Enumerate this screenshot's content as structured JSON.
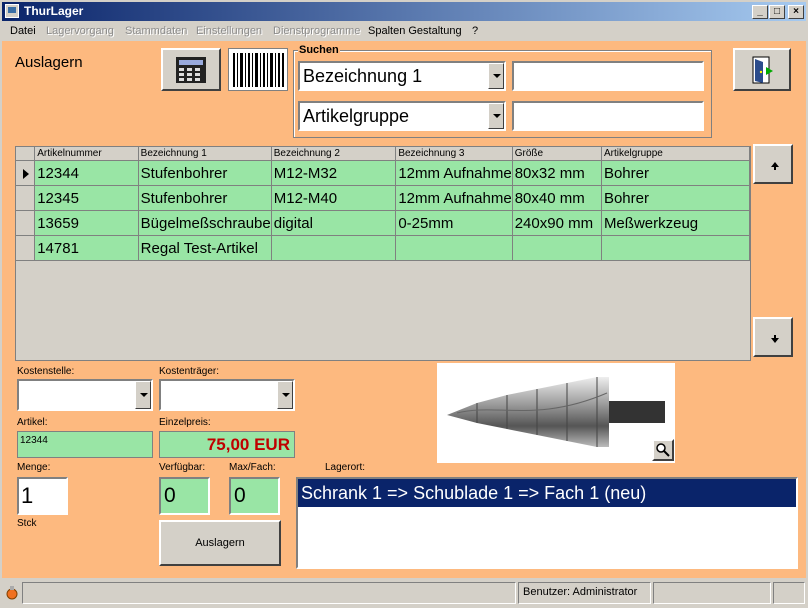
{
  "window": {
    "title": "ThurLager"
  },
  "menu": {
    "items": [
      {
        "label": "Datei",
        "enabled": true
      },
      {
        "label": "Lagervorgang",
        "enabled": false
      },
      {
        "label": "Stammdaten",
        "enabled": false
      },
      {
        "label": "Einstellungen",
        "enabled": false
      },
      {
        "label": "Dienstprogramme",
        "enabled": false
      },
      {
        "label": "Spalten Gestaltung",
        "enabled": true
      },
      {
        "label": "?",
        "enabled": true
      }
    ]
  },
  "page": {
    "title": "Auslagern"
  },
  "search": {
    "group_label": "Suchen",
    "combo1": "Bezeichnung 1",
    "combo2": "Artikelgruppe",
    "field1_value": "",
    "field2_value": ""
  },
  "table": {
    "columns": [
      "Artikelnummer",
      "Bezeichnung 1",
      "Bezeichnung 2",
      "Bezeichnung 3",
      "Größe",
      "Artikelgruppe"
    ],
    "rows": [
      [
        "12344",
        "Stufenbohrer",
        "M12-M32",
        "12mm Aufnahme",
        "80x32 mm",
        "Bohrer"
      ],
      [
        "12345",
        "Stufenbohrer",
        "M12-M40",
        "12mm Aufnahme",
        "80x40 mm",
        "Bohrer"
      ],
      [
        "13659",
        "Bügelmeßschraube",
        "digital",
        "0-25mm",
        "240x90 mm",
        "Meßwerkzeug"
      ],
      [
        "14781",
        "Regal Test-Artikel",
        "",
        "",
        "",
        ""
      ]
    ]
  },
  "form": {
    "kostenstelle_label": "Kostenstelle:",
    "kostentraeger_label": "Kostenträger:",
    "kostenstelle_value": "",
    "kostentraeger_value": "",
    "artikel_label": "Artikel:",
    "artikel_value": "12344",
    "einzelpreis_label": "Einzelpreis:",
    "einzelpreis_value": "75,00 EUR",
    "menge_label": "Menge:",
    "menge_value": "1",
    "unit": "Stck",
    "verfuegbar_label": "Verfügbar:",
    "verfuegbar_value": "0",
    "maxfach_label": "Max/Fach:",
    "maxfach_value": "0",
    "lagerort_label": "Lagerort:",
    "lagerort_value": "Schrank 1 => Schublade 1 => Fach 1 (neu)",
    "auslagern_button": "Auslagern"
  },
  "status": {
    "user": "Benutzer: Administrator"
  },
  "colors": {
    "client_bg": "#fdb97f",
    "grid_row": "#99e5a5",
    "price": "#c00000",
    "selection": "#0a246a"
  }
}
